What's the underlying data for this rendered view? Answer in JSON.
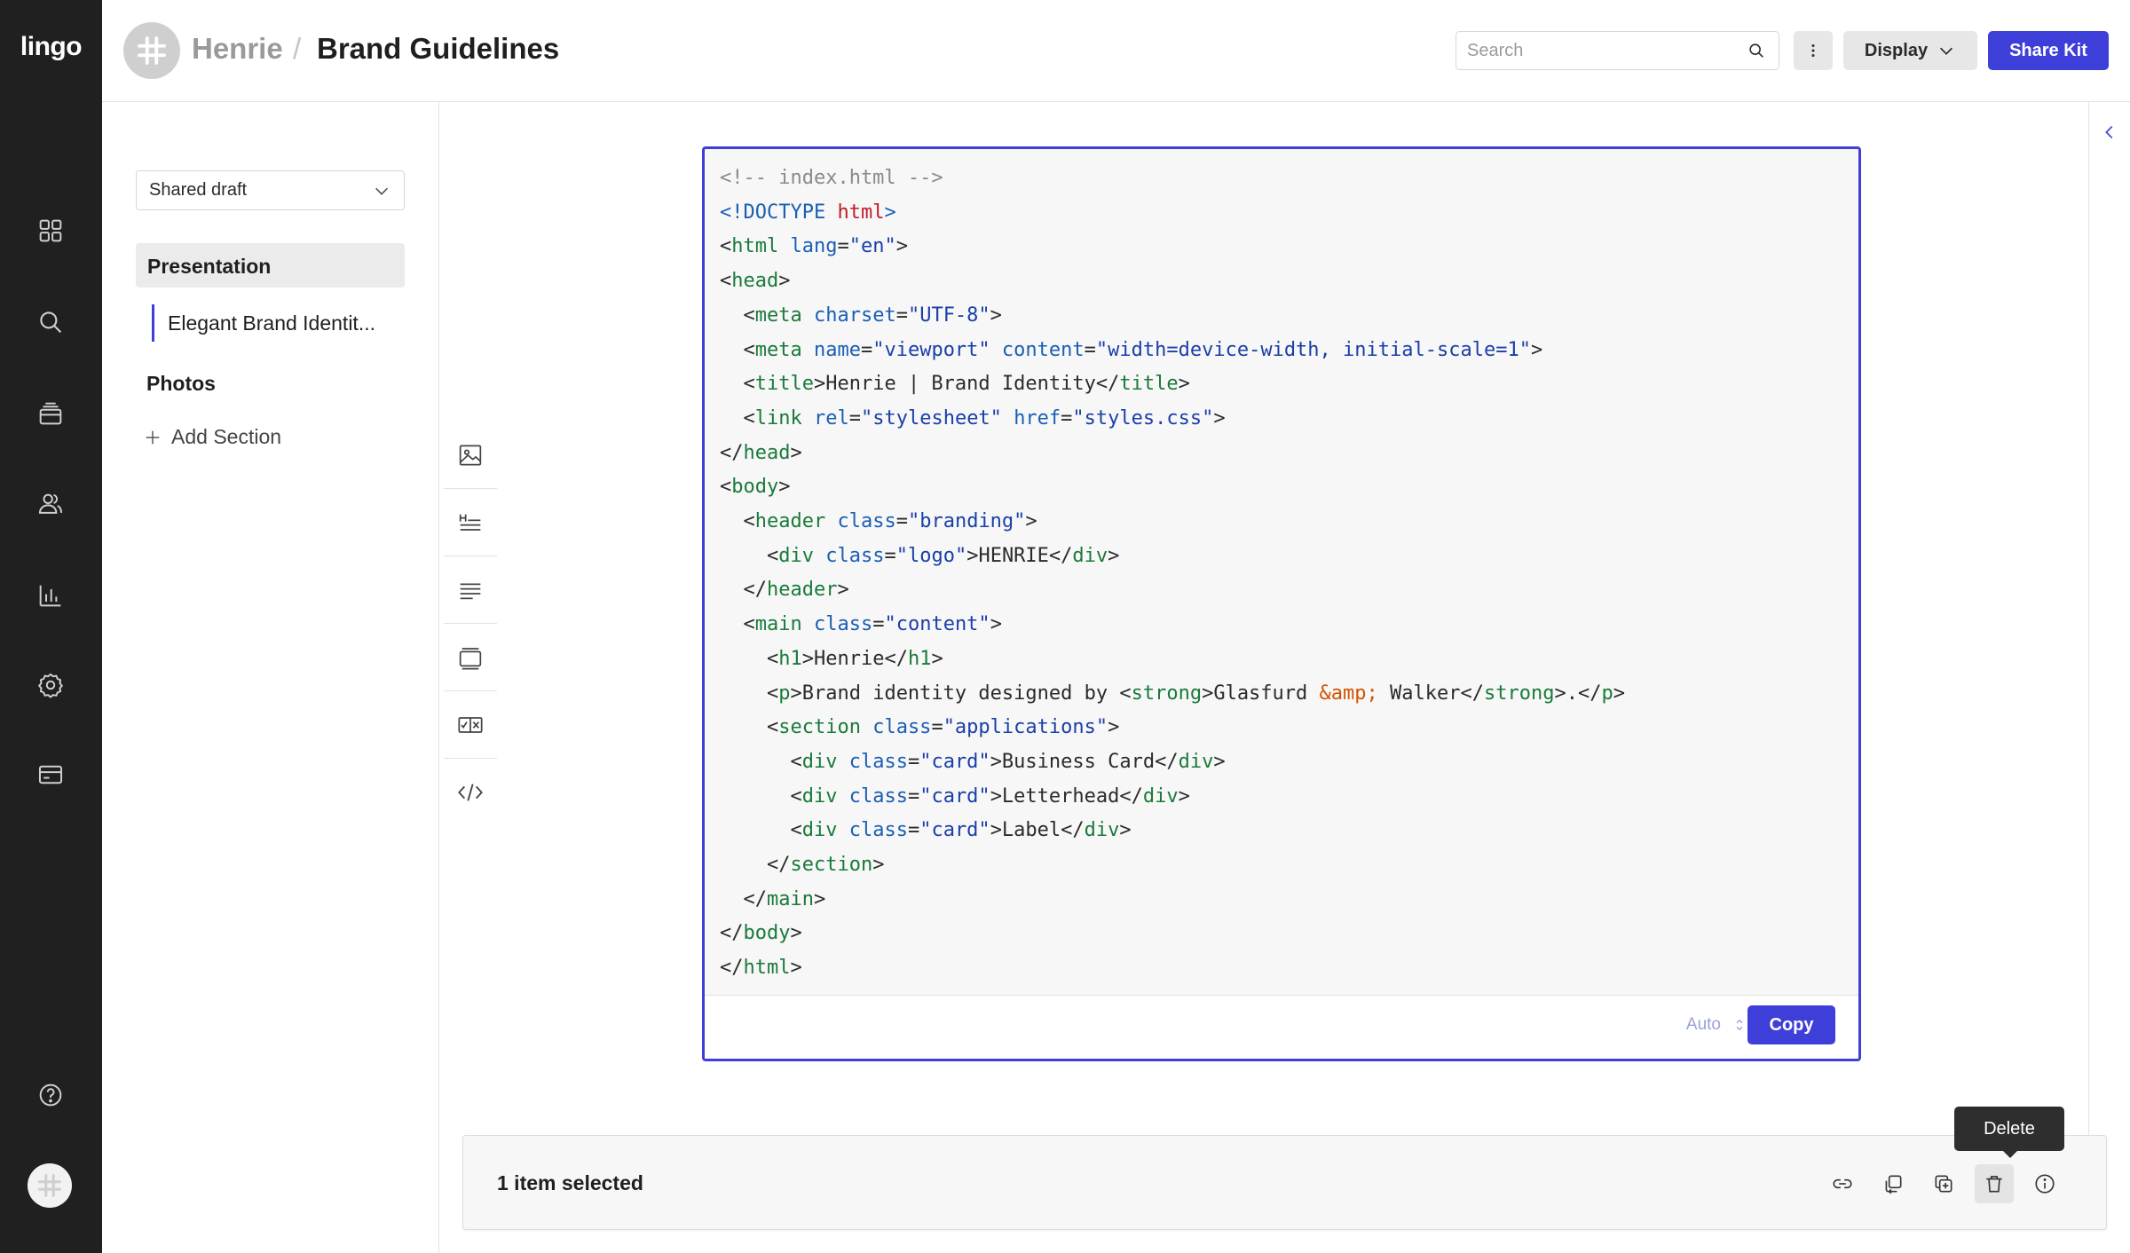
{
  "app": {
    "logo": "lingo"
  },
  "rail": {
    "items": [
      {
        "icon": "grid-icon"
      },
      {
        "icon": "search-icon"
      },
      {
        "icon": "archive-icon"
      },
      {
        "icon": "people-icon"
      },
      {
        "icon": "bar-chart-icon"
      },
      {
        "icon": "gear-icon"
      },
      {
        "icon": "billing-card-icon"
      }
    ],
    "help_icon": "help-icon",
    "workspace_avatar_icon": "hash-avatar-icon"
  },
  "header": {
    "kit_owner": "Henrie",
    "separator": "/",
    "kit_title": "Brand Guidelines",
    "search_placeholder": "Search",
    "display_label": "Display",
    "share_label": "Share Kit"
  },
  "sidebar": {
    "version": "Shared draft",
    "sections": [
      {
        "label": "Presentation",
        "pages": [
          {
            "label": "Elegant Brand Identit..."
          }
        ]
      },
      {
        "label": "Photos",
        "pages": []
      }
    ],
    "add_section_label": "Add Section"
  },
  "block_tools": [
    {
      "icon": "image-icon"
    },
    {
      "icon": "heading-icon"
    },
    {
      "icon": "text-icon"
    },
    {
      "icon": "gallery-icon"
    },
    {
      "icon": "guide-icon"
    },
    {
      "icon": "code-icon"
    }
  ],
  "code_block": {
    "language": "Auto",
    "copy_label": "Copy"
  },
  "selection": {
    "count_label": "1 item selected",
    "actions": [
      "link-icon",
      "move-icon",
      "duplicate-icon",
      "trash-icon",
      "info-icon"
    ],
    "tooltip": "Delete"
  },
  "colors": {
    "rail": "#202020",
    "accent": "#3d3fd8",
    "panel": "#f7f7f7"
  }
}
